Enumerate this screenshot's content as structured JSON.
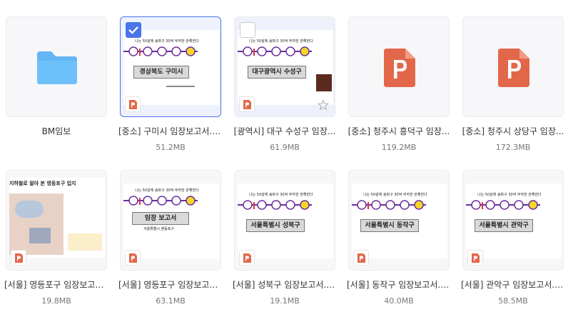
{
  "files": [
    {
      "name": "BM임보",
      "size": "",
      "type": "folder"
    },
    {
      "name": "[중소] 구미시 임장보고서.p...",
      "size": "51.2MB",
      "type": "ppt",
      "slide_title": "경상북도 구미시",
      "slide_header": "나는 50살에 송파구 30억 부자한 관해한다",
      "selected": true
    },
    {
      "name": "[광역시] 대구 수성구 임장...",
      "size": "61.9MB",
      "type": "ppt",
      "slide_title": "대구광역시 수성구",
      "slide_header": "나는 50살에 송파구 30억 부자한 관해한다"
    },
    {
      "name": "[중소] 청주시 흥덕구 임장...",
      "size": "119.2MB",
      "type": "ppt-icon"
    },
    {
      "name": "[중소] 청주시 상당구 임장...",
      "size": "172.3MB",
      "type": "ppt-icon"
    },
    {
      "name": "[서울] 영등포구 임장보고서...",
      "size": "19.8MB",
      "type": "ppt",
      "slide_title": "지하철로 알아 본 영등포구 입지"
    },
    {
      "name": "[서울] 영등포구 임장보고서...",
      "size": "63.1MB",
      "type": "ppt",
      "slide_title": "임장 보고서",
      "slide_sub": "서울특별시 영등포구",
      "slide_header": "나는 50살에 송파구 30억 부자한 관해한다"
    },
    {
      "name": "[서울] 성북구 임장보고서.p...",
      "size": "19.1MB",
      "type": "ppt",
      "slide_title": "서울특별시 성북구",
      "slide_header": "나는 50살에 송파구 30억 부자한 관해한다"
    },
    {
      "name": "[서울] 동작구 임장보고서.p...",
      "size": "40.0MB",
      "type": "ppt",
      "slide_title": "서울특별시 동작구",
      "slide_header": "나는 50살에 송파구 30억 부자한 관해한다"
    },
    {
      "name": "[서울] 관악구 임장보고서.p...",
      "size": "58.5MB",
      "type": "ppt",
      "slide_title": "서울특별시 관악구",
      "slide_header": "나는 50살에 송파구 30억 부자한 관해한다"
    }
  ],
  "colors": {
    "accent": "#4a74e8",
    "ppt": "#e2674a",
    "folder": "#64b5f6",
    "timeline": "#6a2fa0",
    "highlight": "#f4d728"
  }
}
